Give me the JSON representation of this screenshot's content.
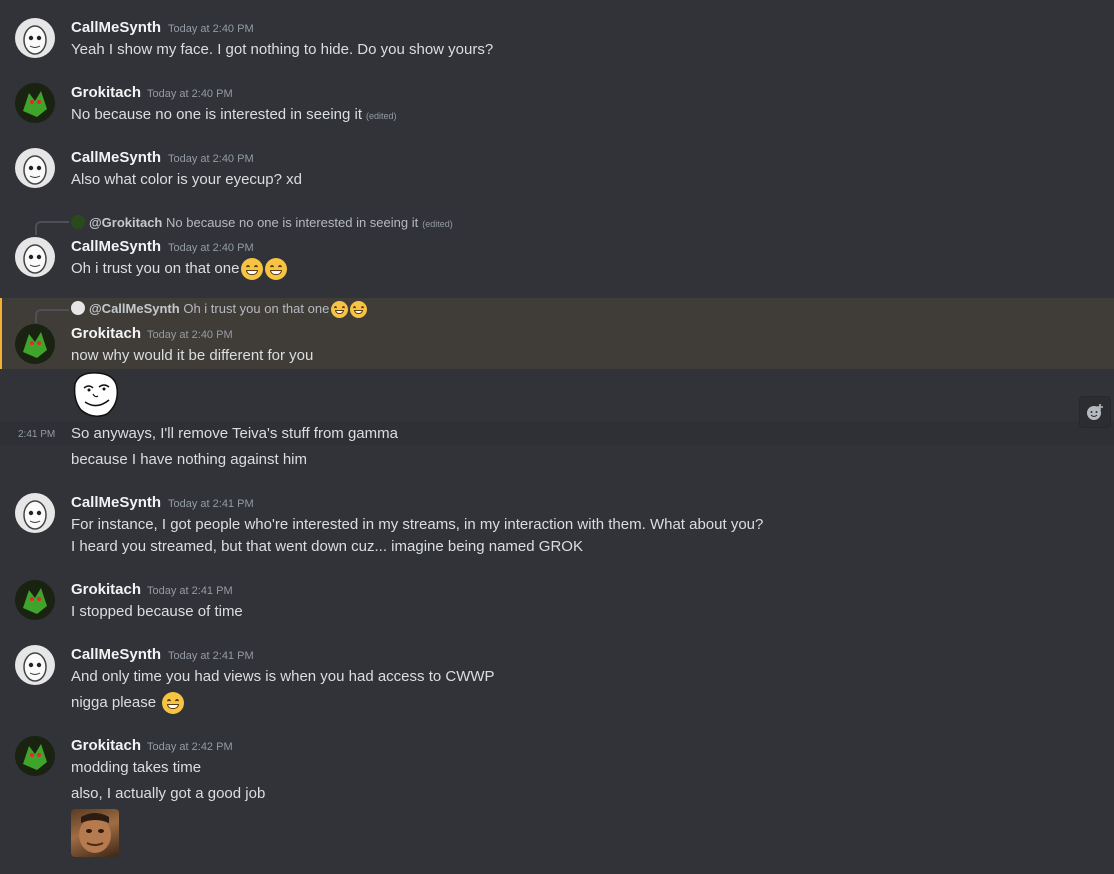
{
  "messages": [
    {
      "author": "CallMeSynth",
      "time": "Today at 2:40 PM",
      "lines": [
        "Yeah I show my face. I got nothing to hide. Do you show yours?"
      ]
    },
    {
      "author": "Grokitach",
      "time": "Today at 2:40 PM",
      "lines": [
        "No because no one is interested in seeing it"
      ],
      "edited": "(edited)"
    },
    {
      "author": "CallMeSynth",
      "time": "Today at 2:40 PM",
      "lines": [
        "Also what color is your eyecup? xd"
      ]
    },
    {
      "author": "CallMeSynth",
      "time": "Today at 2:40 PM",
      "lines": [
        "Oh i trust you on that one"
      ],
      "reply": {
        "name": "@Grokitach",
        "text": "No because no one is interested in seeing it",
        "edited": "(edited)"
      }
    },
    {
      "author": "Grokitach",
      "time": "Today at 2:40 PM",
      "lines": [
        "now why would it be different for you"
      ],
      "reply": {
        "name": "@CallMeSynth",
        "text": "Oh i trust you on that one"
      }
    },
    {
      "author": "",
      "time": "2:41 PM",
      "lines": [
        "So anyways, I'll remove Teiva's stuff from gamma",
        "because I have nothing against him"
      ]
    },
    {
      "author": "CallMeSynth",
      "time": "Today at 2:41 PM",
      "lines": [
        "For instance, I got people who're interested in my streams, in my interaction with them. What about you?",
        "I heard you streamed, but that went down cuz... imagine being named GROK"
      ]
    },
    {
      "author": "Grokitach",
      "time": "Today at 2:41 PM",
      "lines": [
        "I stopped because of time"
      ]
    },
    {
      "author": "CallMeSynth",
      "time": "Today at 2:41 PM",
      "lines": [
        "And only time you had views is when you had access to CWWP",
        "nigga please"
      ]
    },
    {
      "author": "Grokitach",
      "time": "Today at 2:42 PM",
      "lines": [
        "modding takes time",
        "also, I actually got a good job"
      ]
    }
  ],
  "icons": {
    "add_reaction": "add-reaction-icon",
    "emoji": "grinning-emoji",
    "sticker": "trollface-sticker"
  },
  "colors": {
    "highlight_bg": "#403d38",
    "highlight_bar": "#f0b232",
    "background": "#313338"
  }
}
